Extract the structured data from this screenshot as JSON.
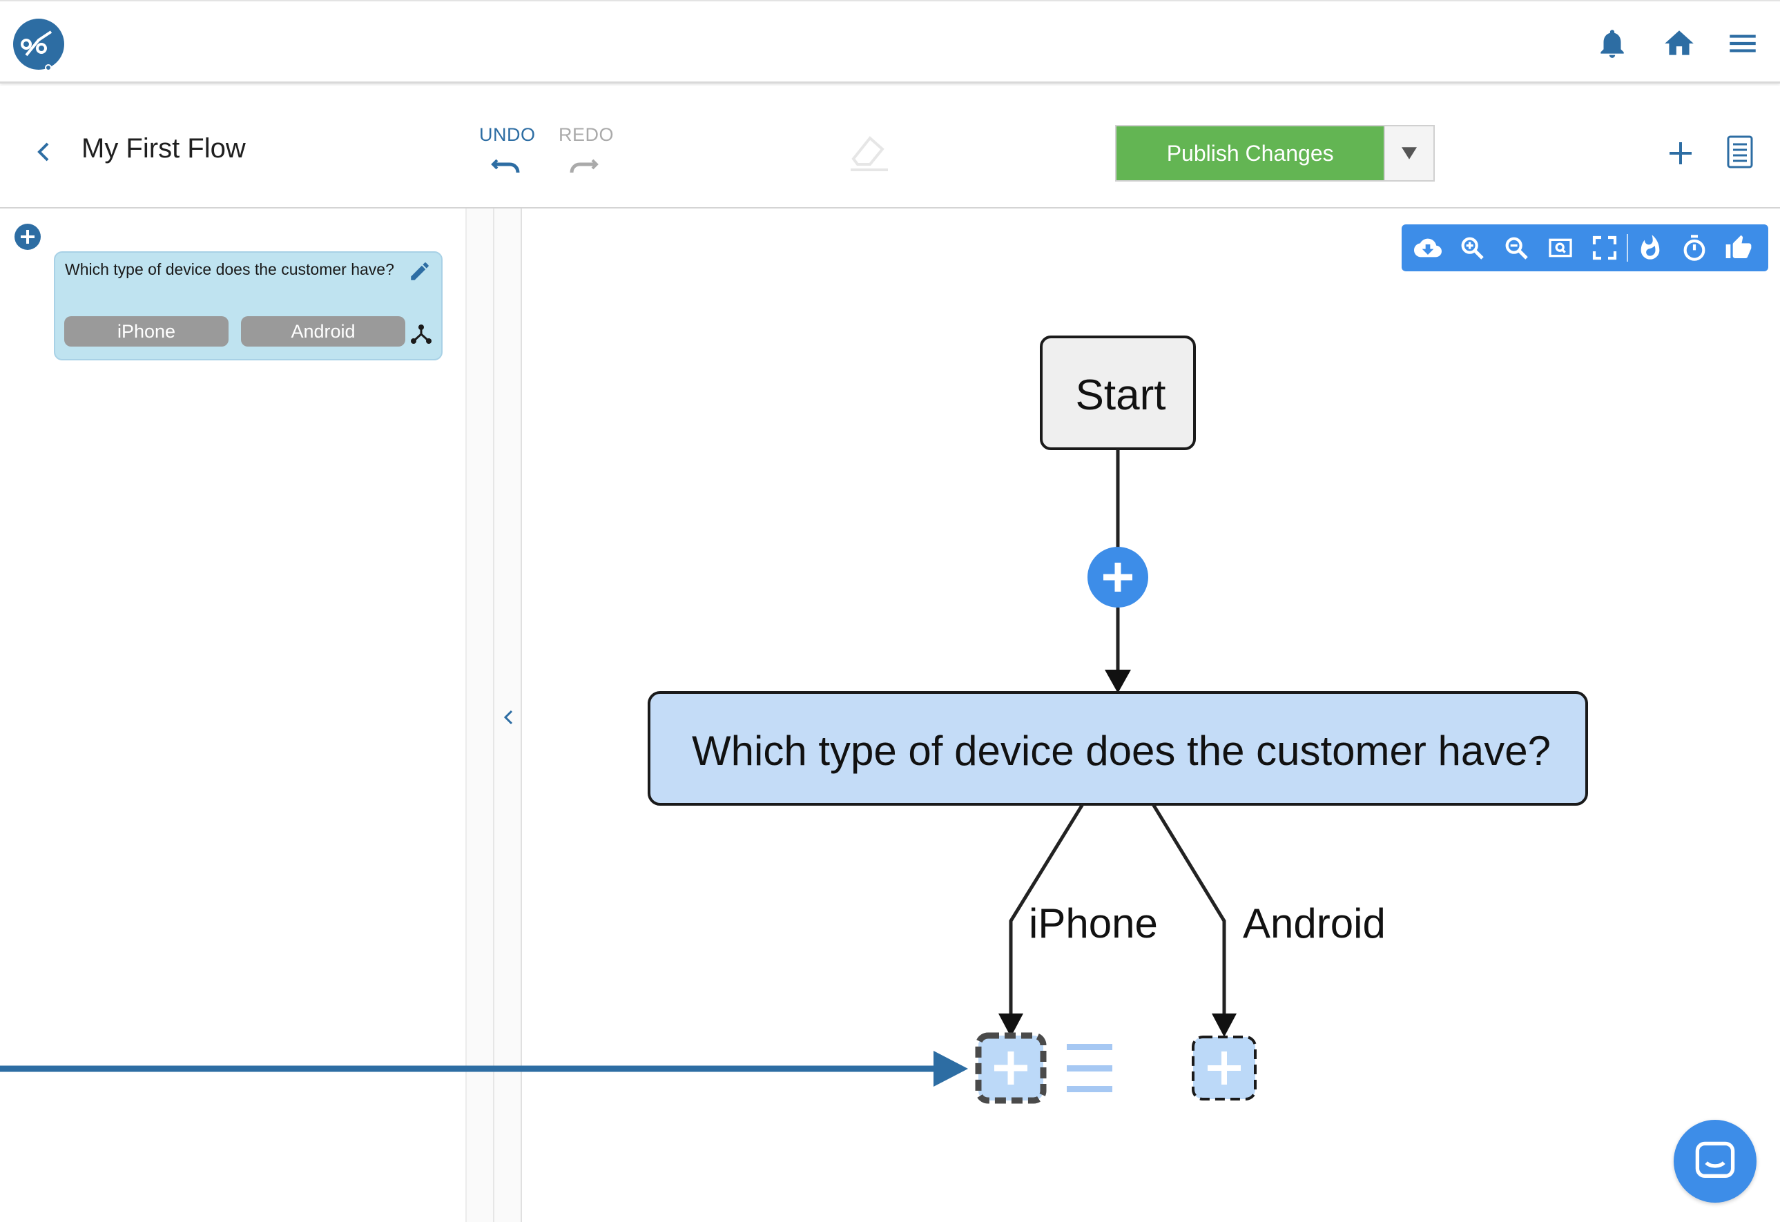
{
  "topbar": {
    "logo_icon": "flow-logo-icon",
    "icons": [
      "bell-icon",
      "home-icon",
      "menu-icon"
    ],
    "accent_color": "#2d6da3"
  },
  "header": {
    "flow_title": "My First Flow",
    "undo_label": "UNDO",
    "redo_label": "REDO",
    "publish_label": "Publish Changes",
    "publish_color": "#63b553"
  },
  "left_panel": {
    "card": {
      "question": "Which type of device does the customer have?",
      "answers": [
        "iPhone",
        "Android"
      ]
    }
  },
  "canvas": {
    "toolbar_icons": [
      "cloud-download-icon",
      "zoom-in-icon",
      "zoom-out-icon",
      "zoom-fit-icon",
      "fullscreen-icon",
      "hot-icon",
      "timer-icon",
      "thumbs-up-icon"
    ],
    "toolbar_color": "#3d8de8",
    "nodes": {
      "start": "Start",
      "question": "Which type of device does the customer have?",
      "branch_iphone": "iPhone",
      "branch_android": "Android"
    }
  }
}
